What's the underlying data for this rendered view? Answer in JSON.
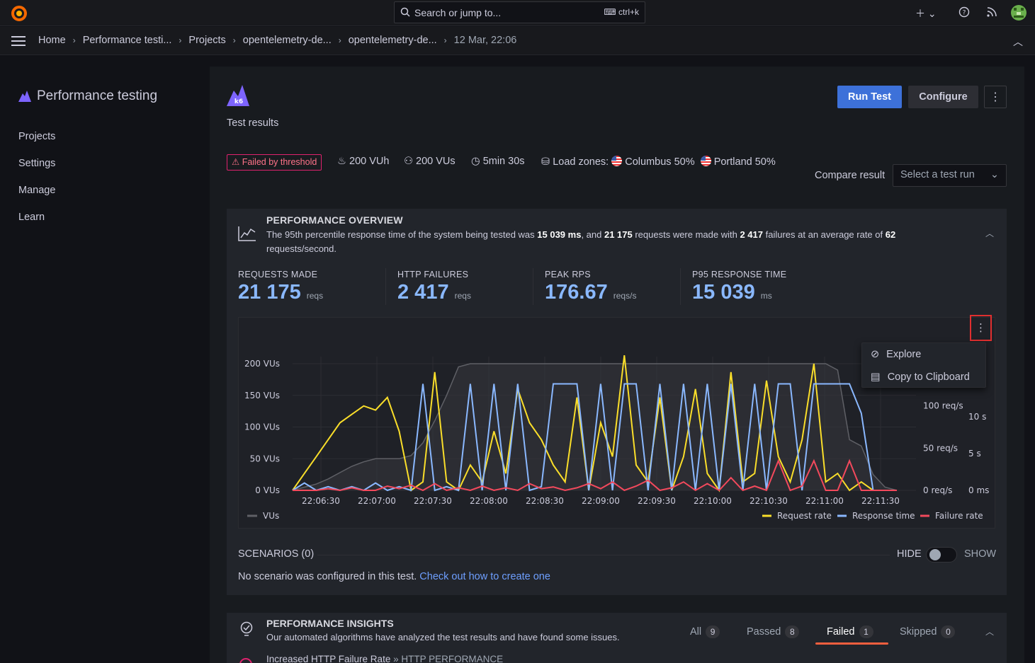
{
  "topbar": {
    "search_placeholder": "Search or jump to...",
    "search_shortcut": "ctrl+k"
  },
  "breadcrumbs": [
    "Home",
    "Performance testi...",
    "Projects",
    "opentelemetry-de...",
    "opentelemetry-de...",
    "12 Mar, 22:06"
  ],
  "sidebar": {
    "title": "Performance testing",
    "items": [
      "Projects",
      "Settings",
      "Manage",
      "Learn"
    ]
  },
  "header": {
    "subtitle": "Test results",
    "run_test": "Run Test",
    "configure": "Configure"
  },
  "summary": {
    "status_badge": "Failed by threshold",
    "vuh": "200 VUh",
    "vus": "200 VUs",
    "duration": "5min 30s",
    "load_zones_label": "Load zones:",
    "zone1": "Columbus 50%",
    "zone2": "Portland 50%",
    "compare_label": "Compare result",
    "compare_placeholder": "Select a test run"
  },
  "overview": {
    "title": "PERFORMANCE OVERVIEW",
    "desc_1": "The 95th percentile response time of the system being tested was ",
    "p95_ms": "15 039 ms",
    "desc_2": ", and ",
    "requests": "21 175",
    "desc_3": " requests were made with ",
    "failures": "2 417",
    "desc_4": " failures at an average rate of ",
    "rate": "62",
    "desc_5": " requests/second.",
    "stats": [
      {
        "label": "REQUESTS MADE",
        "value": "21 175",
        "unit": "reqs"
      },
      {
        "label": "HTTP FAILURES",
        "value": "2 417",
        "unit": "reqs"
      },
      {
        "label": "PEAK RPS",
        "value": "176.67",
        "unit": "reqs/s"
      },
      {
        "label": "P95 RESPONSE TIME",
        "value": "15 039",
        "unit": "ms"
      }
    ]
  },
  "context_menu": {
    "explore": "Explore",
    "copy": "Copy to Clipboard"
  },
  "chart_data": {
    "type": "line",
    "x": [
      "22:06:30",
      "22:07:00",
      "22:07:30",
      "22:08:00",
      "22:08:30",
      "22:09:00",
      "22:09:30",
      "22:10:00",
      "22:10:30",
      "22:11:00",
      "22:11:30"
    ],
    "y_left_ticks": [
      "0 VUs",
      "50 VUs",
      "100 VUs",
      "150 VUs",
      "200 VUs"
    ],
    "y_right_rate_ticks": [
      "0 req/s",
      "50 req/s",
      "100 req/s"
    ],
    "y_right_time_ticks": [
      "0 ms",
      "5 s",
      "10 s"
    ],
    "series": [
      {
        "name": "VUs",
        "color": "#5f6066",
        "values": [
          0,
          5,
          10,
          18,
          28,
          38,
          45,
          50,
          50,
          50,
          55,
          75,
          110,
          150,
          195,
          200,
          200,
          200,
          200,
          200,
          200,
          200,
          200,
          200,
          200,
          200,
          200,
          200,
          200,
          200,
          200,
          200,
          200,
          200,
          200,
          200,
          200,
          200,
          200,
          200,
          200,
          200,
          200,
          200,
          200,
          200,
          190,
          80,
          70,
          25,
          5,
          0
        ]
      },
      {
        "name": "Request rate",
        "color": "#fade2a",
        "values": [
          0,
          20,
          40,
          60,
          80,
          90,
          100,
          95,
          110,
          70,
          0,
          10,
          140,
          10,
          0,
          30,
          10,
          70,
          20,
          120,
          80,
          60,
          30,
          10,
          110,
          0,
          80,
          40,
          160,
          30,
          10,
          110,
          0,
          40,
          120,
          20,
          0,
          140,
          10,
          20,
          130,
          40,
          10,
          60,
          150,
          10,
          20,
          0,
          10,
          0,
          0,
          0
        ]
      },
      {
        "name": "Response time",
        "color": "#8ab8ff",
        "values": [
          0,
          1,
          0,
          0.5,
          0,
          0.5,
          0,
          1,
          0,
          0.5,
          0,
          14.5,
          0,
          0.5,
          0,
          14.5,
          0,
          14.5,
          0,
          14.5,
          0,
          0.5,
          14.5,
          14.5,
          14.5,
          0,
          14.5,
          0,
          14.5,
          14.5,
          0,
          14.5,
          0,
          14.5,
          0,
          14.5,
          0,
          14.5,
          0,
          14.5,
          0,
          14.5,
          14.5,
          0,
          14.5,
          14.5,
          14.5,
          14.5,
          10.5,
          0,
          0,
          0
        ]
      },
      {
        "name": "Failure rate",
        "color": "#f2495c",
        "values": [
          0,
          0,
          0,
          2,
          0,
          3,
          0,
          0,
          5,
          2,
          6,
          0,
          8,
          0,
          3,
          0,
          5,
          0,
          3,
          0,
          8,
          2,
          4,
          0,
          3,
          8,
          2,
          10,
          0,
          5,
          12,
          0,
          3,
          10,
          0,
          8,
          0,
          15,
          0,
          5,
          0,
          35,
          0,
          5,
          35,
          0,
          0,
          35,
          0,
          0,
          0,
          0
        ]
      }
    ]
  },
  "scenarios": {
    "title": "SCENARIOS (0)",
    "hide": "HIDE",
    "show": "SHOW",
    "message": "No scenario was configured in this test.",
    "link": "Check out how to create one"
  },
  "insights": {
    "title": "PERFORMANCE INSIGHTS",
    "desc": "Our automated algorithms have analyzed the test results and have found some issues.",
    "tabs": [
      {
        "label": "All",
        "count": "9"
      },
      {
        "label": "Passed",
        "count": "8"
      },
      {
        "label": "Failed",
        "count": "1"
      },
      {
        "label": "Skipped",
        "count": "0"
      }
    ],
    "row_title": "Increased HTTP Failure Rate",
    "row_category": "HTTP PERFORMANCE"
  }
}
